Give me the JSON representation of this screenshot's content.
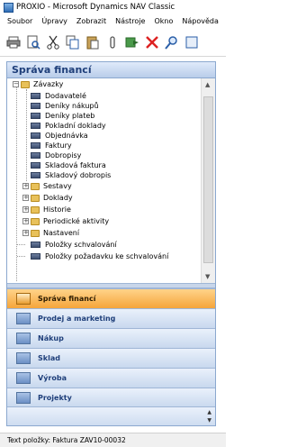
{
  "window": {
    "title": "PROXIO - Microsoft Dynamics NAV Classic"
  },
  "menu": [
    "Soubor",
    "Úpravy",
    "Zobrazit",
    "Nástroje",
    "Okno",
    "Nápověda"
  ],
  "toolbar": {
    "icons": [
      "print-icon",
      "print-preview-icon",
      "cut-icon",
      "copy-icon",
      "paste-icon",
      "attach-icon",
      "refresh-icon",
      "delete-icon",
      "find-icon",
      "more-icon"
    ]
  },
  "panel": {
    "title": "Správa financí",
    "tree": [
      {
        "label": "Závazky",
        "kind": "folder",
        "expanded": true,
        "level": 0
      },
      {
        "label": "Dodavatelé",
        "kind": "item",
        "level": 1
      },
      {
        "label": "Deníky nákupů",
        "kind": "item",
        "level": 1
      },
      {
        "label": "Deníky plateb",
        "kind": "item",
        "level": 1
      },
      {
        "label": "Pokladní doklady",
        "kind": "item",
        "level": 1
      },
      {
        "label": "Objednávka",
        "kind": "item",
        "level": 1
      },
      {
        "label": "Faktury",
        "kind": "item",
        "level": 1
      },
      {
        "label": "Dobropisy",
        "kind": "item",
        "level": 1
      },
      {
        "label": "Skladová faktura",
        "kind": "item",
        "level": 1
      },
      {
        "label": "Skladový dobropis",
        "kind": "item",
        "level": 1
      },
      {
        "label": "Sestavy",
        "kind": "folder",
        "expanded": false,
        "level": 1
      },
      {
        "label": "Doklady",
        "kind": "folder",
        "expanded": false,
        "level": 1
      },
      {
        "label": "Historie",
        "kind": "folder",
        "expanded": false,
        "level": 1
      },
      {
        "label": "Periodické aktivity",
        "kind": "folder",
        "expanded": false,
        "level": 1
      },
      {
        "label": "Nastavení",
        "kind": "folder",
        "expanded": false,
        "level": 1
      },
      {
        "label": "Položky schvalování",
        "kind": "item",
        "level": 1
      },
      {
        "label": "Položky požadavku ke schvalování",
        "kind": "item",
        "level": 1
      }
    ]
  },
  "nav_buttons": [
    {
      "label": "Správa financí",
      "active": true
    },
    {
      "label": "Prodej a marketing",
      "active": false
    },
    {
      "label": "Nákup",
      "active": false
    },
    {
      "label": "Sklad",
      "active": false
    },
    {
      "label": "Výroba",
      "active": false
    },
    {
      "label": "Projekty",
      "active": false
    }
  ],
  "status": {
    "text": "Text položky: Faktura ZAV10-00032"
  },
  "colors": {
    "active_nav": "#f5a53a",
    "header_text": "#1f3f7a",
    "panel_border": "#8ba8cf"
  }
}
